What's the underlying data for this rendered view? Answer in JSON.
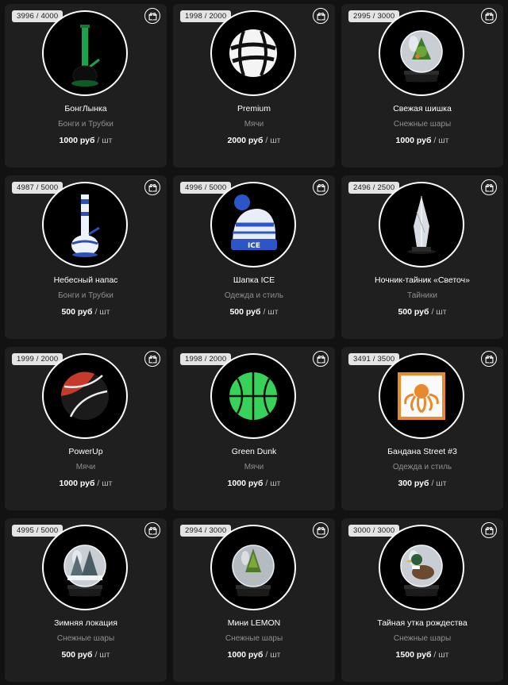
{
  "colors": {
    "background": "#121212",
    "card": "#1f1f1f",
    "badge": "#e4e4e4",
    "muted": "#8f8f8f"
  },
  "products": [
    {
      "stock": "3996 / 4000",
      "title": "БонгЛынка",
      "category": "Бонги и Трубки",
      "price": "1000 руб",
      "unit": "/ шт",
      "image": "green-glass-bong"
    },
    {
      "stock": "1998 / 2000",
      "title": "Premium",
      "category": "Мячи",
      "price": "2000 руб",
      "unit": "/ шт",
      "image": "white-black-ball"
    },
    {
      "stock": "2995 / 3000",
      "title": "Свежая шишка",
      "category": "Снежные шары",
      "price": "1000 руб",
      "unit": "/ шт",
      "image": "snow-globe-cone"
    },
    {
      "stock": "4987 / 5000",
      "title": "Небесный напас",
      "category": "Бонги и Трубки",
      "price": "500 руб",
      "unit": "/ шт",
      "image": "blue-white-bong"
    },
    {
      "stock": "4996 / 5000",
      "title": "Шапка ICE",
      "category": "Одежда и стиль",
      "price": "500 руб",
      "unit": "/ шт",
      "image": "knit-beanie"
    },
    {
      "stock": "2496 / 2500",
      "title": "Ночник-тайник «Светоч»",
      "category": "Тайники",
      "price": "500 руб",
      "unit": "/ шт",
      "image": "crystal-lamp"
    },
    {
      "stock": "1999 / 2000",
      "title": "PowerUp",
      "category": "Мячи",
      "price": "1000 руб",
      "unit": "/ шт",
      "image": "red-black-ball"
    },
    {
      "stock": "1998 / 2000",
      "title": "Green Dunk",
      "category": "Мячи",
      "price": "1000 руб",
      "unit": "/ шт",
      "image": "green-basketball"
    },
    {
      "stock": "3491 / 3500",
      "title": "Бандана Street #3",
      "category": "Одежда и стиль",
      "price": "300 руб",
      "unit": "/ шт",
      "image": "octopus-bandana"
    },
    {
      "stock": "4995 / 5000",
      "title": "Зимняя локация",
      "category": "Снежные шары",
      "price": "500 руб",
      "unit": "/ шт",
      "image": "snow-globe-trees"
    },
    {
      "stock": "2994 / 3000",
      "title": "Мини LEMON",
      "category": "Снежные шары",
      "price": "1000 руб",
      "unit": "/ шт",
      "image": "snow-globe-plant"
    },
    {
      "stock": "3000 / 3000",
      "title": "Тайная утка рождества",
      "category": "Снежные шары",
      "price": "1500 руб",
      "unit": "/ шт",
      "image": "snow-globe-duck"
    }
  ]
}
